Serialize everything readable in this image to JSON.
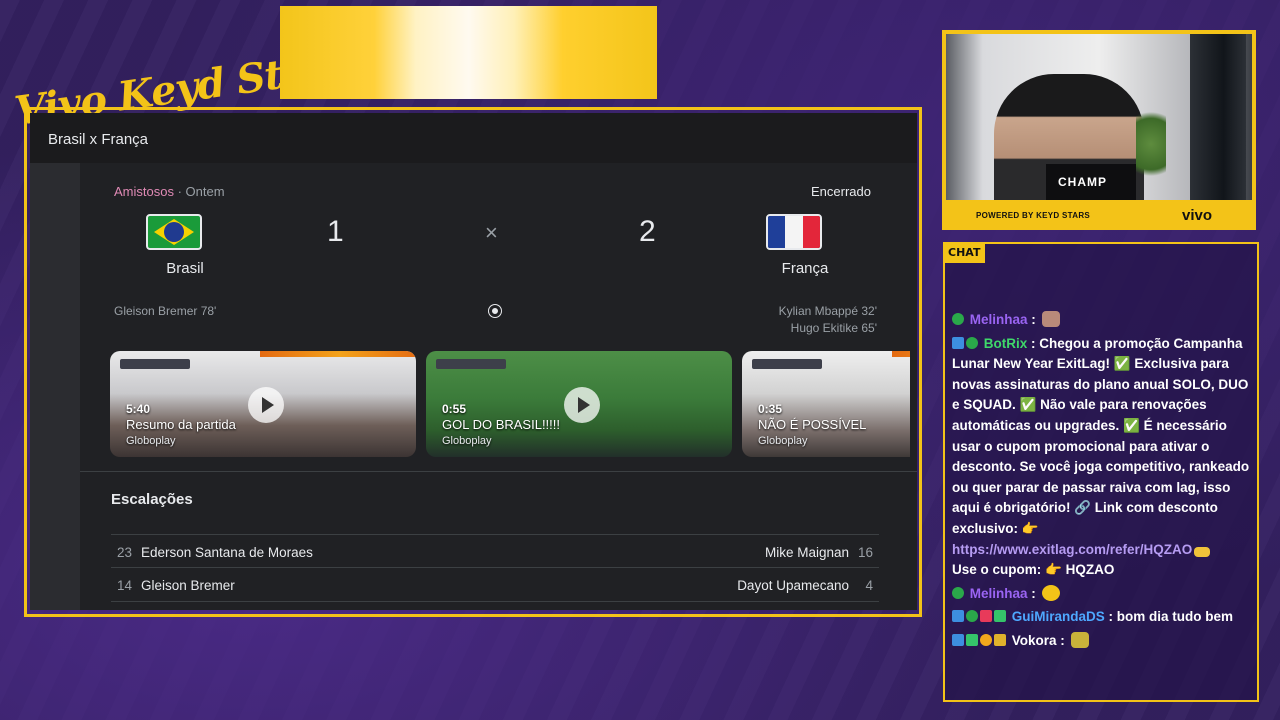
{
  "overlay": {
    "brand": "Vivo Keyd Stars"
  },
  "screen": {
    "title": "Brasil x França",
    "competition": "Amistosos",
    "when": "Ontem",
    "status": "Encerrado",
    "home": {
      "name": "Brasil",
      "score": "1"
    },
    "away": {
      "name": "França",
      "score": "2"
    },
    "separator": "×",
    "home_scorers": [
      "Gleison Bremer 78'"
    ],
    "away_scorers": [
      "Kylian Mbappé 32'",
      "Hugo Ekitike 65'"
    ],
    "videos": [
      {
        "duration": "5:40",
        "title": "Resumo da partida",
        "source": "Globoplay"
      },
      {
        "duration": "0:55",
        "title": "GOL DO BRASIL!!!!!",
        "source": "Globoplay"
      },
      {
        "duration": "0:35",
        "title": "NÃO É POSSÍVEL",
        "source": "Globoplay"
      }
    ],
    "lineups_title": "Escalações",
    "lineups": [
      {
        "home_num": "23",
        "home_name": "Ederson Santana de Moraes",
        "away_name": "Mike Maignan",
        "away_num": "16"
      },
      {
        "home_num": "14",
        "home_name": "Gleison Bremer",
        "away_name": "Dayot Upamecano",
        "away_num": "4"
      }
    ]
  },
  "camera": {
    "chair_label": "CHAMP",
    "powered_by": "POWERED BY",
    "sponsor_logo": "KEYD STARS",
    "sponsor": "vivo"
  },
  "chat": {
    "label": "CHAT",
    "messages": [
      {
        "user": "Melinhaa",
        "text": ""
      },
      {
        "user": "BotRix",
        "text": "Chegou a promoção Campanha Lunar New Year ExitLag! ✅ Exclusiva para novas assinaturas do plano anual SOLO, DUO e SQUAD. ✅ Não vale para renovações automáticas ou upgrades. ✅ É necessário usar o cupom promocional para ativar o desconto. Se você joga competitivo, rankeado ou quer parar de passar raiva com lag, isso aqui é obrigatório! 🔗 Link com desconto exclusivo: 👉",
        "link": "https://www.exitlag.com/refer/HQZAO",
        "tail": "Use o cupom: 👉 HQZAO"
      },
      {
        "user": "Melinhaa",
        "text": ""
      },
      {
        "user": "GuiMirandaDS",
        "text": "bom dia tudo bem"
      },
      {
        "user": "Vokora",
        "text": ""
      }
    ]
  },
  "colors": {
    "accent": "#f3c318",
    "background": "#33205f",
    "card": "#202124"
  }
}
